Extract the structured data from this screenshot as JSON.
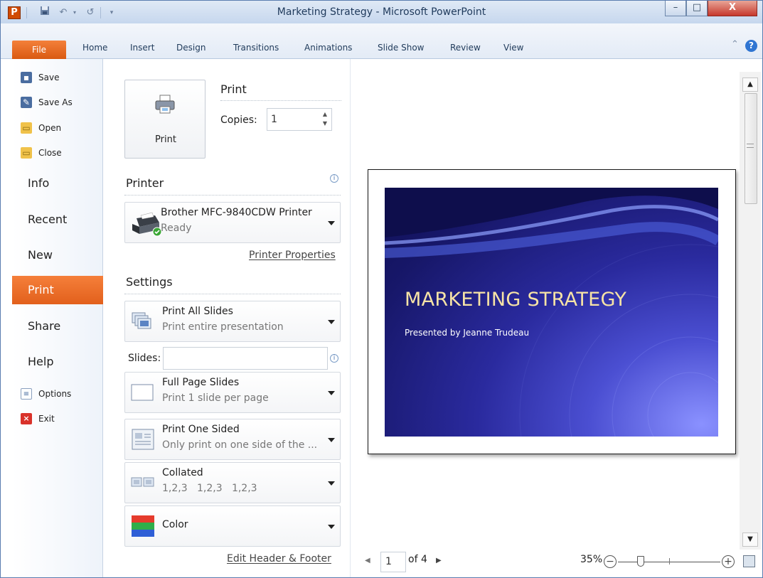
{
  "window": {
    "title": "Marketing Strategy - Microsoft PowerPoint",
    "app_icon": "P",
    "minimize": "–",
    "maximize": "□",
    "close": "X"
  },
  "quick_access": [
    {
      "icon": "save-icon"
    },
    {
      "icon": "undo-icon"
    },
    {
      "icon": "redo-icon"
    },
    {
      "icon": "customize-icon"
    }
  ],
  "ribbon": {
    "file_tab": "File",
    "tabs": [
      "Home",
      "Insert",
      "Design",
      "Transitions",
      "Animations",
      "Slide Show",
      "Review",
      "View"
    ],
    "minimize_icon": "chevron-up-icon",
    "help_label": "?"
  },
  "backstage_nav": {
    "commands": [
      {
        "label": "Save",
        "icon": "save-icon"
      },
      {
        "label": "Save As",
        "icon": "save-as-icon"
      },
      {
        "label": "Open",
        "icon": "open-folder-icon"
      },
      {
        "label": "Close",
        "icon": "close-folder-icon"
      }
    ],
    "sections": [
      "Info",
      "Recent",
      "New",
      "Print",
      "Share",
      "Help"
    ],
    "active": "Print",
    "footer": [
      {
        "label": "Options",
        "icon": "options-icon"
      },
      {
        "label": "Exit",
        "icon": "exit-icon"
      }
    ]
  },
  "print_panel": {
    "print_button": "Print",
    "heading": "Print",
    "copies_label": "Copies:",
    "copies_value": "1",
    "printer_heading": "Printer",
    "printer_name": "Brother MFC-9840CDW Printer",
    "printer_status": "Ready",
    "printer_properties": "Printer Properties",
    "settings_heading": "Settings",
    "print_range": {
      "title": "Print All Slides",
      "desc": "Print entire presentation"
    },
    "slides_label": "Slides:",
    "slides_value": "",
    "layout": {
      "title": "Full Page Slides",
      "desc": "Print 1 slide per page"
    },
    "sides": {
      "title": "Print One Sided",
      "desc": "Only print on one side of the ..."
    },
    "collation": {
      "title": "Collated",
      "desc": "1,2,3   1,2,3   1,2,3"
    },
    "color": {
      "title": "Color"
    },
    "edit_header_footer": "Edit Header & Footer"
  },
  "preview": {
    "slide_title": "MARKETING STRATEGY",
    "slide_subtitle": "Presented by Jeanne Trudeau",
    "page_current": "1",
    "page_of": "of 4",
    "zoom_percent": "35%",
    "zoom_level": 0.35
  },
  "colors": {
    "accent": "#e2601c",
    "ribbon": "#dfe9f5",
    "slide_title": "#f6e3a6"
  }
}
